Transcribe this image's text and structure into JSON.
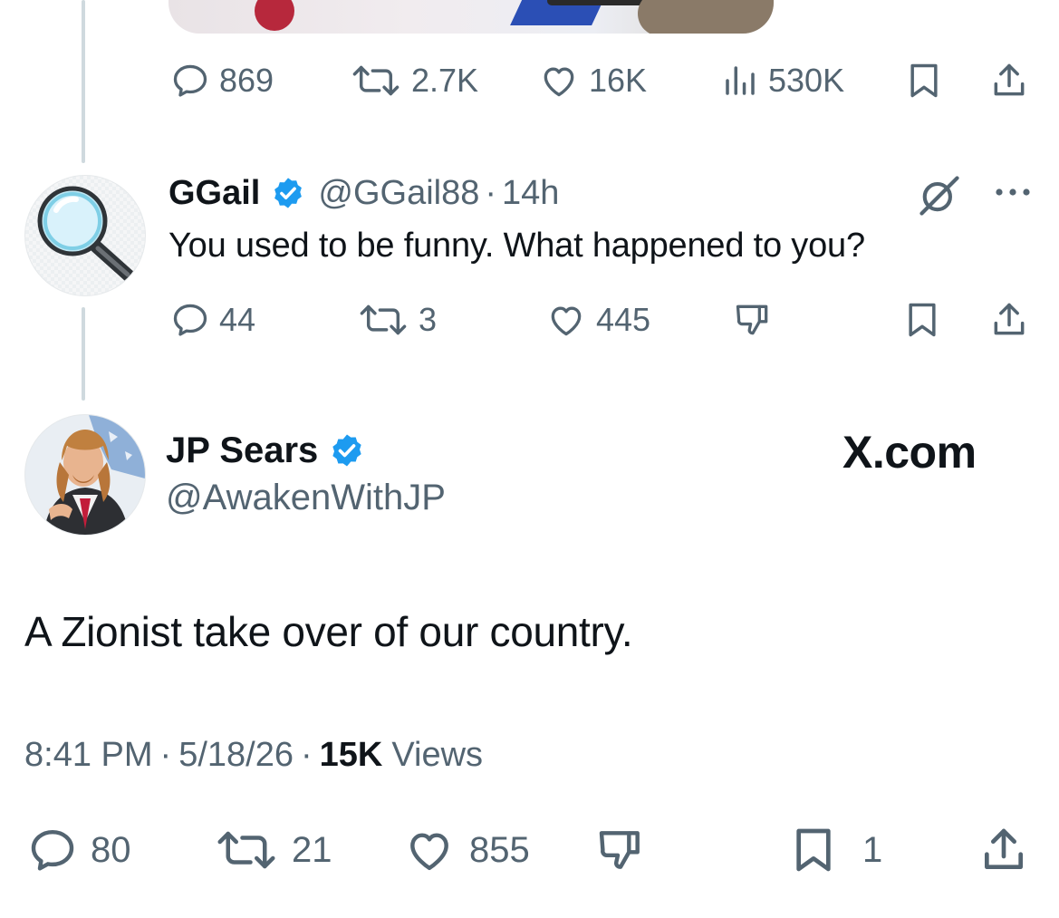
{
  "previous_tweet": {
    "actions": {
      "replies": "869",
      "reposts": "2.7K",
      "likes": "16K",
      "views": "530K"
    }
  },
  "reply_tweet": {
    "display_name": "GGail",
    "handle": "@GGail88",
    "separator": "·",
    "time": "14h",
    "text": "You used to be funny. What happened to you?",
    "actions": {
      "replies": "44",
      "reposts": "3",
      "likes": "445"
    }
  },
  "main_tweet": {
    "display_name": "JP Sears",
    "handle": "@AwakenWithJP",
    "watermark": "X.com",
    "text": "A Zionist take over of our country.",
    "time": "8:41 PM",
    "date": "5/18/26",
    "separator": "·",
    "views_count": "15K",
    "views_label": "Views",
    "actions": {
      "replies": "80",
      "reposts": "21",
      "likes": "855",
      "bookmarks": "1"
    }
  },
  "icons": [
    "reply-icon",
    "repost-icon",
    "like-icon",
    "views-icon",
    "bookmark-icon",
    "share-icon",
    "dislike-icon",
    "grok-icon",
    "more-icon",
    "verified-badge-icon"
  ],
  "colors": {
    "text_primary": "#0f1419",
    "text_secondary": "#536471",
    "verified_blue": "#1d9bf0",
    "thread_line": "#cfd9de"
  }
}
